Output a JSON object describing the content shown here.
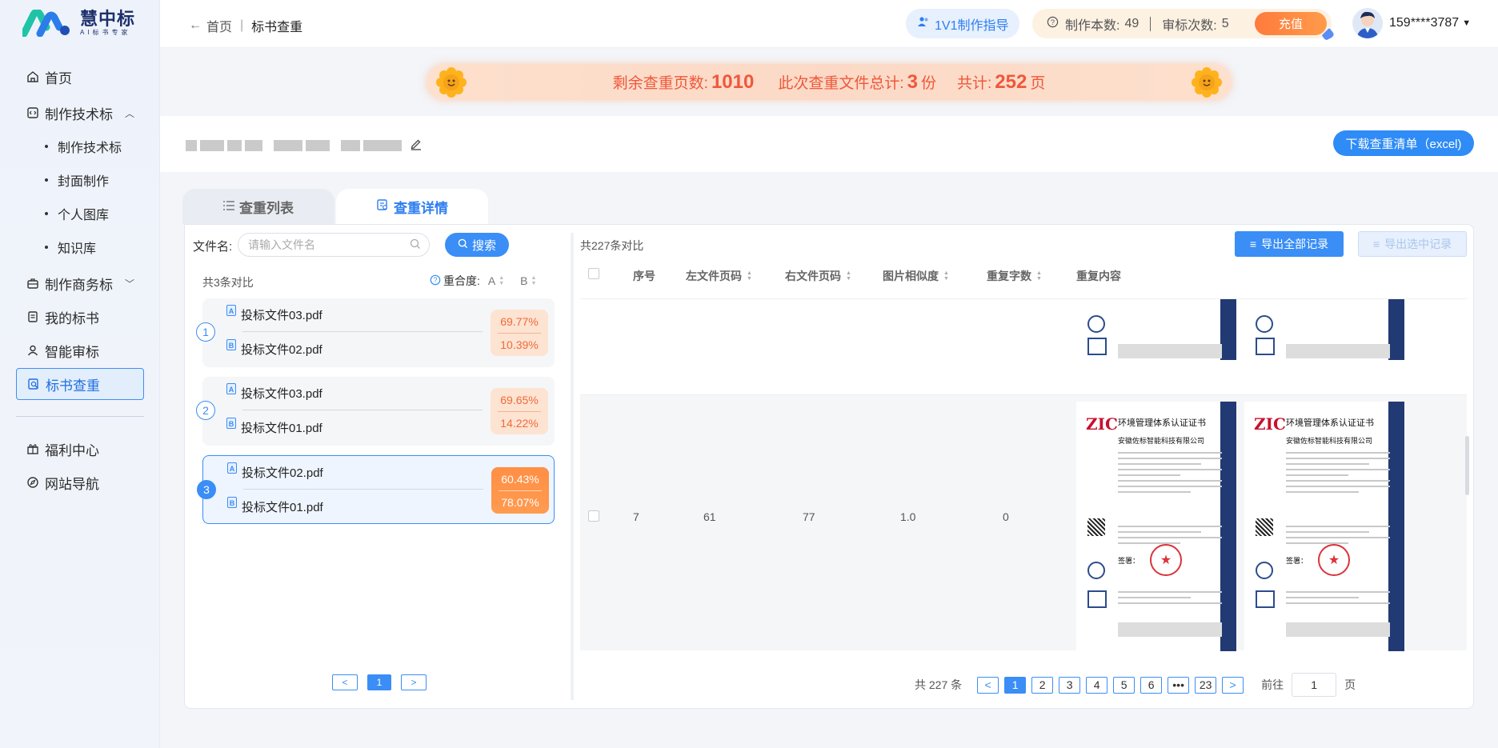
{
  "brand": {
    "name": "慧中标",
    "slogan": "AI标书专家"
  },
  "sidebar": {
    "items": [
      {
        "label": "首页",
        "icon": "home-icon"
      },
      {
        "label": "制作技术标",
        "icon": "code-doc-icon"
      },
      {
        "label": "制作商务标",
        "icon": "briefcase-icon"
      },
      {
        "label": "我的标书",
        "icon": "document-icon"
      },
      {
        "label": "智能审标",
        "icon": "user-check-icon"
      },
      {
        "label": "标书查重",
        "icon": "search-doc-icon"
      },
      {
        "label": "福利中心",
        "icon": "gift-icon"
      },
      {
        "label": "网站导航",
        "icon": "compass-icon"
      }
    ],
    "subitems": [
      "制作技术标",
      "封面制作",
      "个人图库",
      "知识库"
    ]
  },
  "header": {
    "back_label": "首页",
    "current": "标书查重",
    "guide_label": "1V1制作指导",
    "made_label": "制作本数:",
    "made_count": "49",
    "review_label": "审标次数:",
    "review_count": "5",
    "recharge_label": "充值",
    "phone": "159****3787"
  },
  "banner": {
    "remain_label": "剩余查重页数:",
    "remain_value": "1010",
    "files_label": "此次查重文件总计:",
    "files_value": "3",
    "files_unit": "份",
    "total_label": "共计:",
    "total_value": "252",
    "total_unit": "页"
  },
  "title_row": {
    "download_label": "下载查重清单（excel)"
  },
  "tabs": {
    "list_label": "查重列表",
    "detail_label": "查重详情"
  },
  "left_panel": {
    "filename_label": "文件名:",
    "search_placeholder": "请输入文件名",
    "search_button": "搜索",
    "pair_count": "共3条对比",
    "overlap_label": "重合度:",
    "sort_a": "A",
    "sort_b": "B",
    "pairs": [
      {
        "num": "1",
        "a_badge": "A",
        "a_file": "投标文件03.pdf",
        "b_badge": "B",
        "b_file": "投标文件02.pdf",
        "pct_a": "69.77%",
        "pct_b": "10.39%"
      },
      {
        "num": "2",
        "a_badge": "A",
        "a_file": "投标文件03.pdf",
        "b_badge": "B",
        "b_file": "投标文件01.pdf",
        "pct_a": "69.65%",
        "pct_b": "14.22%"
      },
      {
        "num": "3",
        "a_badge": "A",
        "a_file": "投标文件02.pdf",
        "b_badge": "B",
        "b_file": "投标文件01.pdf",
        "pct_a": "60.43%",
        "pct_b": "78.07%"
      }
    ],
    "pager": {
      "prev": "<",
      "current": "1",
      "next": ">"
    }
  },
  "right_panel": {
    "total_compare": "共227条对比",
    "export_all": "导出全部记录",
    "export_selected": "导出选中记录",
    "columns": [
      "序号",
      "左文件页码",
      "右文件页码",
      "图片相似度",
      "重复字数",
      "重复内容"
    ],
    "row": {
      "index": "7",
      "left_page": "61",
      "right_page": "77",
      "similarity": "1.0",
      "repeat_chars": "0"
    },
    "certificate": {
      "logo": "ZIC",
      "title": "环境管理体系认证证书",
      "company": "安徽佐标智能科技有限公司",
      "sign": "签署："
    },
    "pager": {
      "total": "共 227 条",
      "prev": "<",
      "pages": [
        "1",
        "2",
        "3",
        "4",
        "5",
        "6",
        "•••",
        "23"
      ],
      "next": ">",
      "goto_label": "前往",
      "goto_value": "1",
      "goto_unit": "页"
    }
  },
  "colors": {
    "accent": "#3a8ef6",
    "orange": "#f06a3a"
  }
}
